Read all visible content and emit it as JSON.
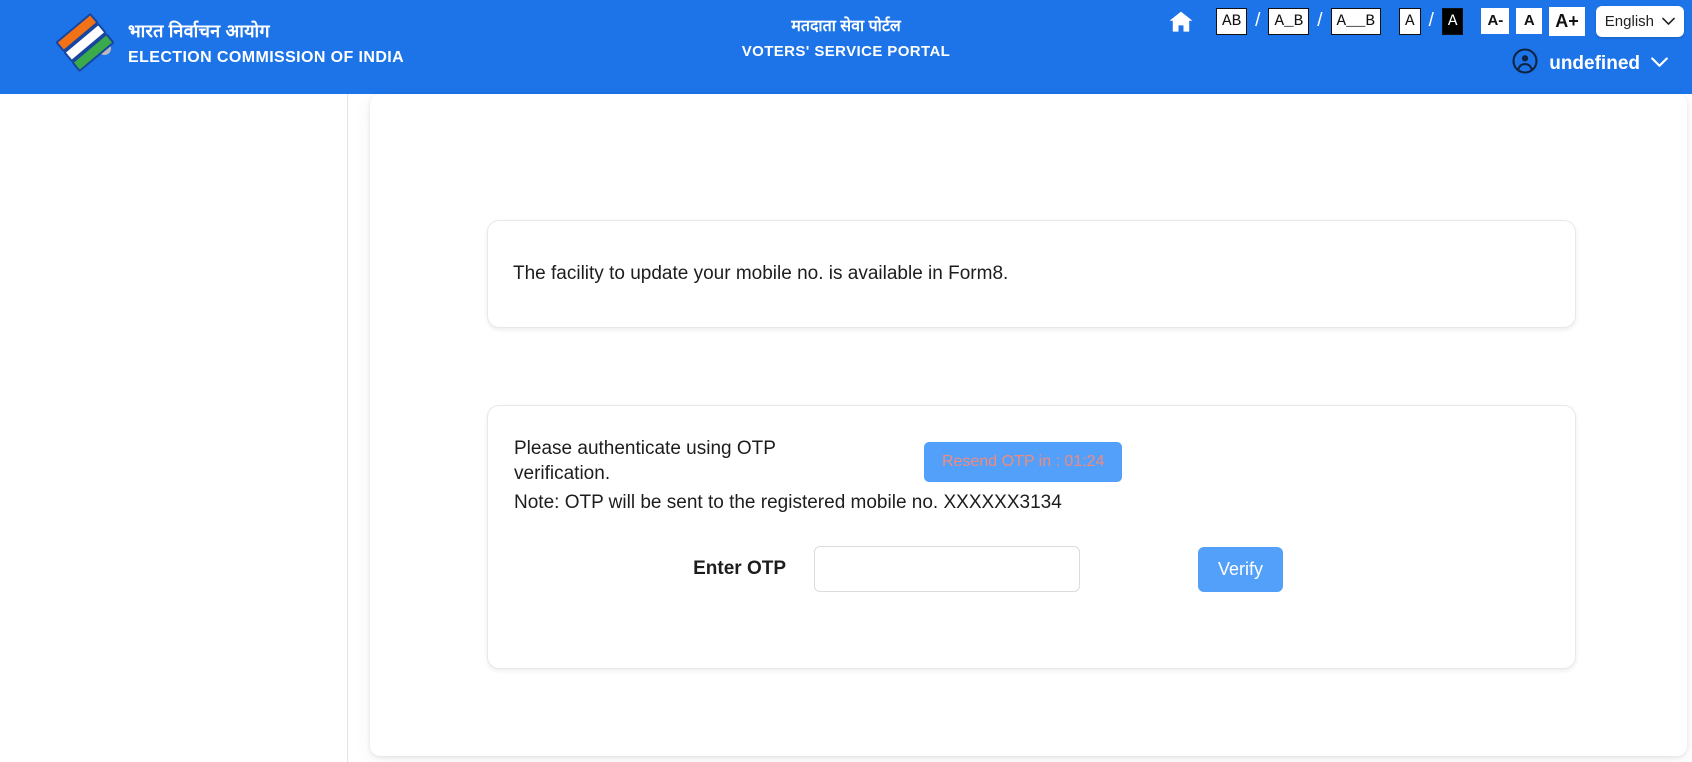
{
  "header": {
    "brand": {
      "logo_icon": "eci-logo-icon",
      "name_hi": "भारत निर्वाचन आयोग",
      "name_en": "ELECTION COMMISSION OF INDIA"
    },
    "center": {
      "title_hi": "मतदाता सेवा पोर्टल",
      "title_en": "VOTERS' SERVICE PORTAL"
    },
    "accessibility": {
      "home_icon": "home-icon",
      "letter_spacing_normal": "AB",
      "letter_spacing_medium": "A_B",
      "letter_spacing_wide": "A__B",
      "separator": "/",
      "contrast_light": "A",
      "contrast_dark": "A",
      "font_decrease": "A-",
      "font_normal": "A",
      "font_increase": "A+"
    },
    "language": {
      "selected": "English",
      "chevron_icon": "chevron-down-icon",
      "options": [
        "English"
      ]
    },
    "user": {
      "avatar_icon": "user-circle-icon",
      "name": "undefined",
      "chevron_icon": "chevron-down-icon"
    },
    "colors": {
      "header_background": "#1d74e8",
      "accent_button": "#53a0fa",
      "resend_text": "#f28a7a"
    }
  },
  "main": {
    "notice": {
      "message": "The facility to update your mobile no. is available in Form8."
    },
    "otp": {
      "prompt": "Please authenticate using OTP verification.",
      "resend_label": "Resend OTP in : 01:24",
      "note": "Note: OTP will be sent to the registered mobile no. XXXXXX3134",
      "input_label": "Enter OTP",
      "input_value": "",
      "input_placeholder": "",
      "verify_label": "Verify"
    }
  }
}
